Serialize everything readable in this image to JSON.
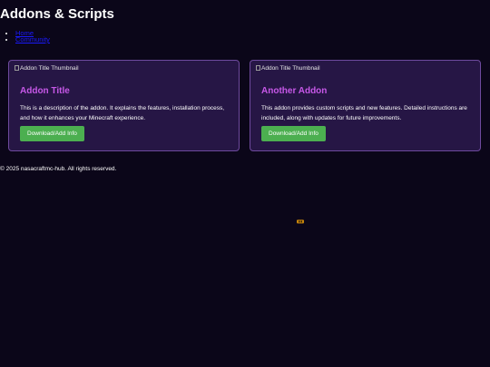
{
  "header": {
    "title": "Addons & Scripts"
  },
  "nav": {
    "items": [
      {
        "label": "Home"
      },
      {
        "label": "Community"
      }
    ]
  },
  "cards": [
    {
      "thumbnail_alt": "Addon Title Thumbnail",
      "title": "Addon Title",
      "description": "This is a description of the addon. It explains the features, installation process, and how it enhances your Minecraft experience.",
      "button_label": "Download/Add Info"
    },
    {
      "thumbnail_alt": "Addon Title Thumbnail",
      "title": "Another Addon",
      "description": "This addon provides custom scripts and new features. Detailed instructions are included, along with updates for future improvements.",
      "button_label": "Download/Add Info"
    }
  ],
  "footer": {
    "text": "© 2025 nasacraftmc-hub. All rights reserved."
  },
  "colors": {
    "background": "#0b0619",
    "card_background": "#261645",
    "card_border": "#6e4a9e",
    "card_title": "#c758e8",
    "button": "#4caf50",
    "link": "#1a1aff"
  },
  "icons": {
    "broken_image": "broken-image-icon",
    "floating_icon": "eye-icon"
  }
}
